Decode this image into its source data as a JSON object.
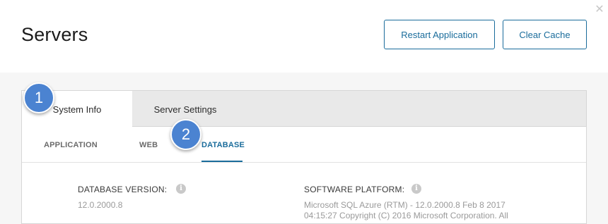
{
  "header": {
    "title": "Servers",
    "close_symbol": "✕",
    "actions": {
      "restart_label": "Restart Application",
      "clear_cache_label": "Clear Cache"
    }
  },
  "tabs": [
    {
      "label": "System Info",
      "active": true
    },
    {
      "label": "Server Settings",
      "active": false
    }
  ],
  "subtabs": [
    {
      "label": "APPLICATION",
      "active": false
    },
    {
      "label": "WEB",
      "active": false
    },
    {
      "label": "DATABASE",
      "active": true
    }
  ],
  "database": {
    "version_label": "DATABASE VERSION:",
    "version_value": "12.0.2000.8",
    "platform_label": "SOFTWARE PLATFORM:",
    "platform_value_line1": "Microsoft SQL Azure (RTM) - 12.0.2000.8 Feb 8 2017",
    "platform_value_line2": "04:15:27 Copyright (C) 2016 Microsoft Corporation. All"
  },
  "info_symbol": "i",
  "callouts": [
    "1",
    "2"
  ],
  "colors": {
    "accent": "#1a6c9b",
    "callout": "#4b83d1"
  }
}
